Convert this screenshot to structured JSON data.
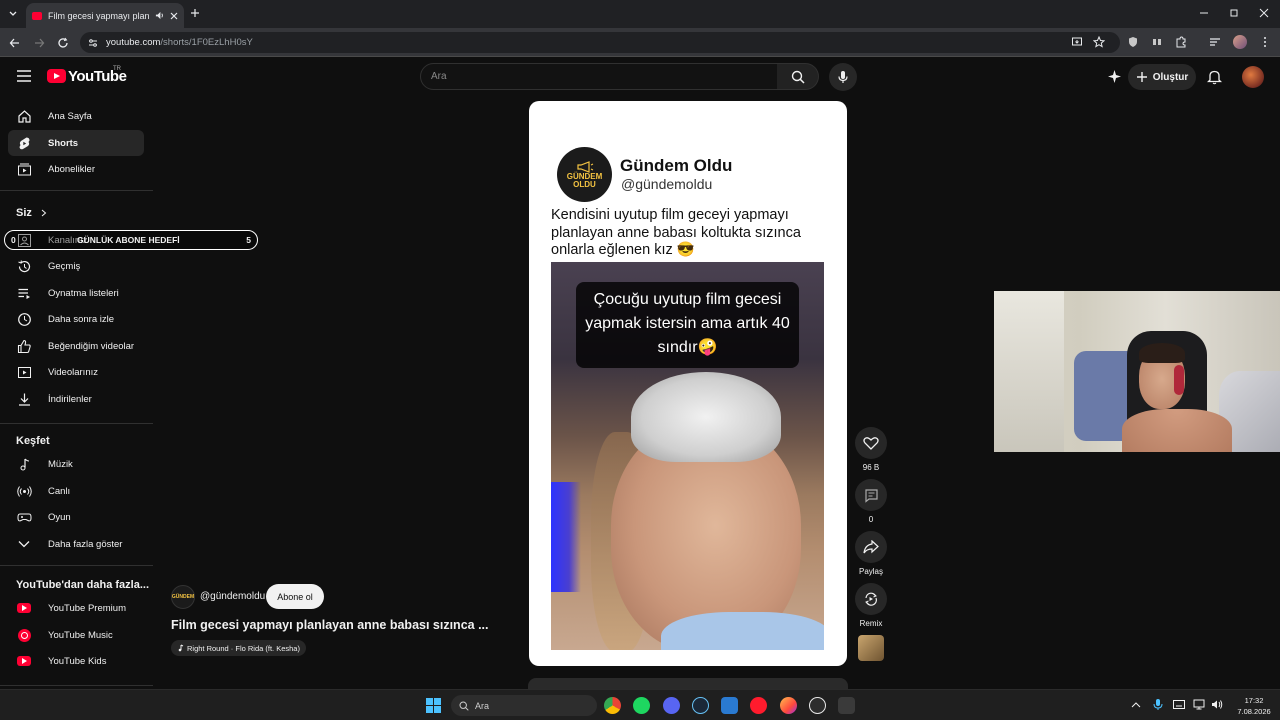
{
  "browser": {
    "tab_title": "Film gecesi yapmayı planlayan anne babası sızınca onlarla eğlenen kız",
    "url_host": "youtube.com",
    "url_path": "/shorts/1F0EzLhH0sY"
  },
  "header": {
    "logo_text": "YouTube",
    "logo_region": "TR",
    "search_placeholder": "Ara",
    "create_label": "Oluştur"
  },
  "sidebar": {
    "main": [
      {
        "label": "Ana Sayfa",
        "icon": "home-icon"
      },
      {
        "label": "Shorts",
        "icon": "shorts-icon"
      },
      {
        "label": "Abonelikler",
        "icon": "subscriptions-icon"
      }
    ],
    "you_heading": "Siz",
    "you": [
      {
        "label": "Kanalınız",
        "icon": "channel-icon"
      },
      {
        "label": "Geçmiş",
        "icon": "history-icon"
      },
      {
        "label": "Oynatma listeleri",
        "icon": "playlists-icon"
      },
      {
        "label": "Daha sonra izle",
        "icon": "watch-later-icon"
      },
      {
        "label": "Beğendiğim videolar",
        "icon": "liked-icon"
      },
      {
        "label": "Videolarınız",
        "icon": "your-videos-icon"
      },
      {
        "label": "İndirilenler",
        "icon": "downloads-icon"
      }
    ],
    "explore_heading": "Keşfet",
    "explore": [
      {
        "label": "Müzik",
        "icon": "music-icon"
      },
      {
        "label": "Canlı",
        "icon": "live-icon"
      },
      {
        "label": "Oyun",
        "icon": "gaming-icon"
      },
      {
        "label": "Daha fazla göster",
        "icon": "chevron-down-icon"
      }
    ],
    "more_heading": "YouTube'dan daha fazla...",
    "more": [
      {
        "label": "YouTube Premium"
      },
      {
        "label": "YouTube Music"
      },
      {
        "label": "YouTube Kids"
      }
    ]
  },
  "goal_overlay": {
    "left_count": "0",
    "label": "GÜNLÜK ABONE HEDEFİ",
    "right_count": "5"
  },
  "short": {
    "avatar_text_1": "GÜNDEM",
    "avatar_text_2": "OLDU",
    "post_name": "Gündem Oldu",
    "post_handle": "@gündemoldu",
    "post_text": "Kendisini uyutup film geceyi yapmayı planlayan anne babası koltukta sızınca onlarla eğlenen kız 😎",
    "video_caption": "Çocuğu uyutup film gecesi yapmak istersin ama artık 40 sındır🤪"
  },
  "actions": {
    "like_count": "96 B",
    "comment_count": "0",
    "share_label": "Paylaş",
    "remix_label": "Remix"
  },
  "channel": {
    "handle": "@gündemoldu",
    "subscribe_label": "Abone ol",
    "video_title": "Film gecesi yapmayı planlayan anne babası sızınca ...",
    "music": "Right Round · Flo Rida (ft. Kesha)"
  },
  "taskbar": {
    "search_placeholder": "Ara",
    "time": "17:32",
    "date": "7.08.2026"
  },
  "colors": {
    "accent": "#ff0033",
    "background": "#0f0f0f",
    "surface": "#272727"
  }
}
